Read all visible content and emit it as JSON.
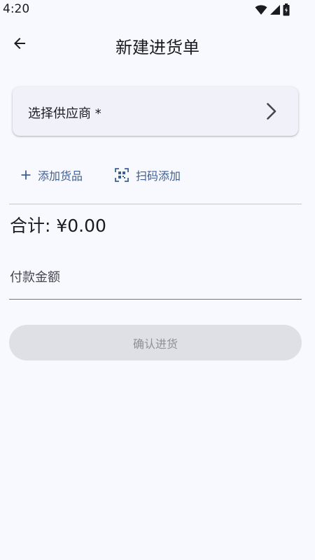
{
  "status_bar": {
    "time": "4:20",
    "icons": [
      "wifi-icon",
      "signal-icon",
      "battery-icon"
    ]
  },
  "app_bar": {
    "back_icon": "arrow-back-icon",
    "title": "新建进货单"
  },
  "supplier": {
    "label": "选择供应商 *",
    "chevron_icon": "chevron-right-icon"
  },
  "actions": {
    "add_goods": {
      "icon": "plus-icon",
      "label": "添加货品"
    },
    "scan_add": {
      "icon": "qr-scan-icon",
      "label": "扫码添加"
    }
  },
  "summary": {
    "total": "合计: ¥0.00"
  },
  "payment": {
    "label": "付款金额",
    "value": ""
  },
  "confirm": {
    "label": "确认进货",
    "enabled": false
  },
  "colors": {
    "background": "#f8f9fe",
    "card": "#f0f1f9",
    "accent": "#3f5f90",
    "disabled_button": "#dfe0e6",
    "disabled_text": "#8f9097"
  }
}
